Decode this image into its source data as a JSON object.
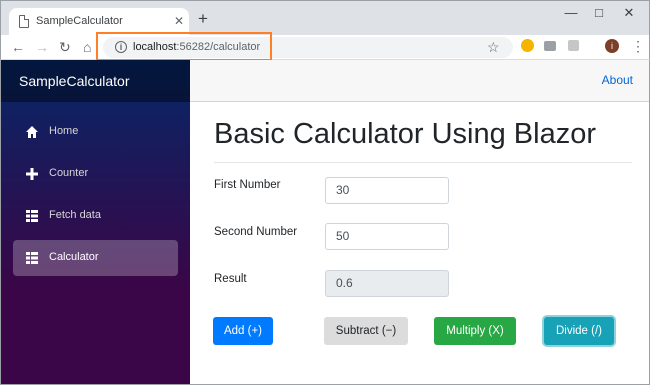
{
  "browser": {
    "tab_title": "SampleCalculator",
    "tab_close": "✕",
    "new_tab": "+",
    "url_host": "localhost",
    "url_rest": ":56282/calculator",
    "profile_initial": "i"
  },
  "app": {
    "brand": "SampleCalculator",
    "about": "About",
    "nav": [
      {
        "label": "Home",
        "icon": "home-icon"
      },
      {
        "label": "Counter",
        "icon": "plus-icon"
      },
      {
        "label": "Fetch data",
        "icon": "list-icon"
      },
      {
        "label": "Calculator",
        "icon": "list-icon"
      }
    ]
  },
  "calculator": {
    "title": "Basic Calculator Using Blazor",
    "first_label": "First Number",
    "first_value": "30",
    "second_label": "Second Number",
    "second_value": "50",
    "result_label": "Result",
    "result_value": "0.6",
    "buttons": {
      "add": "Add (+)",
      "subtract": "Subtract (−)",
      "multiply": "Multiply (X)",
      "divide": "Divide (/)"
    }
  },
  "colors": {
    "primary": "#007bff",
    "success": "#28a745",
    "info": "#17a2b8",
    "highlight": "#ff7f27",
    "link": "#0366d6"
  }
}
